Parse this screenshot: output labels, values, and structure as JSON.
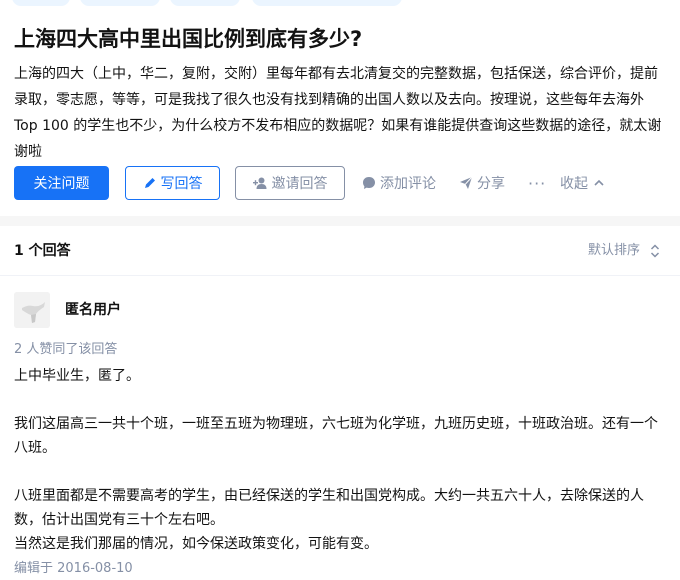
{
  "question": {
    "title": "上海四大高中里出国比例到底有多少?",
    "description": "上海的四大（上中，华二，复附，交附）里每年都有去北清复交的完整数据，包括保送，综合评价，提前录取，零志愿，等等，可是我找了很久也没有找到精确的出国人数以及去向。按理说，这些每年去海外 Top 100 的学生也不少，为什么校方不发布相应的数据呢？如果有谁能提供查询这些数据的途径，就太谢谢啦"
  },
  "actions": {
    "follow": "关注问题",
    "write": "写回答",
    "invite": "邀请回答",
    "comment": "添加评论",
    "share": "分享",
    "more": "···",
    "collapse": "收起"
  },
  "answers_header": {
    "count": "1 个回答",
    "sort": "默认排序"
  },
  "answer": {
    "author": "匿名用户",
    "votes": "2 人赞同了该回答",
    "paragraphs": [
      "上中毕业生，匿了。",
      "我们这届高三一共十个班，一班至五班为物理班，六七班为化学班，九班历史班，十班政治班。还有一个八班。",
      "八班里面都是不需要高考的学生，由已经保送的学生和出国党构成。大约一共五六十人，去除保送的人数，估计出国党有三十个左右吧。",
      "当然这是我们那届的情况，如今保送政策变化，可能有变。"
    ],
    "edited": "编辑于 2016-08-10"
  },
  "colors": {
    "primary": "#1772f6",
    "muted": "#8590a6",
    "text": "#121212",
    "tag_bg": "#ebf5ff"
  },
  "icons": [
    "pen-icon",
    "add-user-icon",
    "comment-icon",
    "share-icon",
    "chevron-up-icon",
    "sort-icon"
  ]
}
